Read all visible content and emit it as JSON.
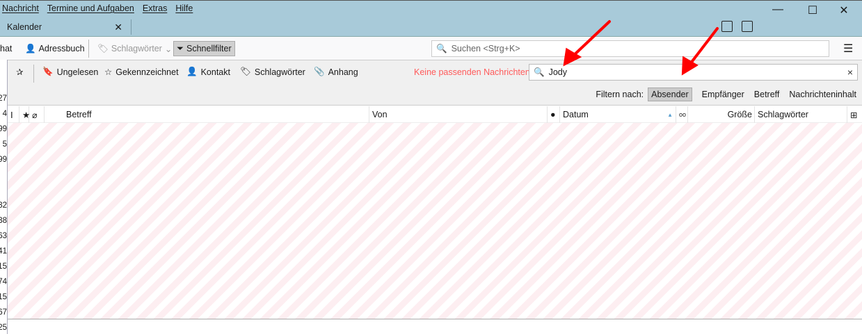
{
  "menu": [
    "Nachricht",
    "Termine und Aufgaben",
    "Extras",
    "Hilfe"
  ],
  "window_controls": {
    "minimize": "—",
    "maximize": "☐",
    "close": "✕"
  },
  "tab": {
    "label": "Kalender",
    "close": "✕"
  },
  "toolbar": {
    "chat": "hat",
    "addressbook": "Adressbuch",
    "tags": "Schlagwörter",
    "quickfilter": "Schnellfilter",
    "search_placeholder": "Suchen <Strg+K>",
    "menu": "☰"
  },
  "quickfilter": {
    "unread": "Ungelesen",
    "starred": "Gekennzeichnet",
    "contact": "Kontakt",
    "tags": "Schlagwörter",
    "attachment": "Anhang",
    "no_match": "Keine passenden Nachrichten",
    "search_value": "Jody",
    "clear": "×",
    "filter_by": "Filtern nach:",
    "filters": [
      {
        "label": "Absender",
        "active": true
      },
      {
        "label": "Empfänger",
        "active": false
      },
      {
        "label": "Betreff",
        "active": false
      },
      {
        "label": "Nachrichteninhalt",
        "active": false
      }
    ]
  },
  "columns": {
    "subject": "Betreff",
    "from": "Von",
    "date": "Datum",
    "size": "Größe",
    "tags": "Schlagwörter"
  },
  "left_counts": [
    "27",
    "4",
    "99",
    "5",
    "99",
    "",
    "",
    "32",
    "38",
    "63",
    "41",
    "15",
    "74",
    "15",
    "67",
    "25"
  ],
  "colors": {
    "titlebar": "#a8cad9",
    "no_match": "#ff5a5a",
    "arrow": "#ff0000"
  }
}
